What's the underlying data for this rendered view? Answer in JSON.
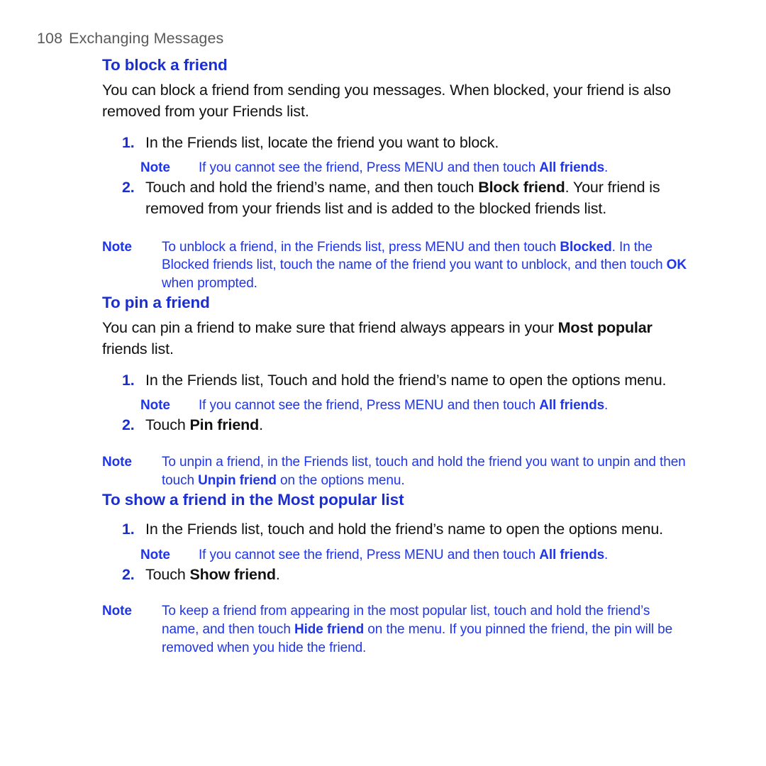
{
  "header": {
    "page_number": "108",
    "chapter_title": "Exchanging Messages"
  },
  "colors": {
    "heading_blue": "#1a2ed2",
    "note_blue": "#1f35e8",
    "body_black": "#111111",
    "header_gray": "#5a5a5a",
    "page_background": "#ffffff"
  },
  "sections": [
    {
      "heading": "To block a friend",
      "intro": "You can block a friend from sending you messages. When blocked, your friend is also removed from your Friends list.",
      "steps": [
        {
          "marker": "1.",
          "text_before": "In the Friends list, locate the friend you want to block.",
          "bold": "",
          "text_after": "",
          "note": {
            "label": "Note",
            "text_before": "If you cannot see the friend, Press MENU and then touch ",
            "bold": "All friends",
            "text_after": "."
          }
        },
        {
          "marker": "2.",
          "text_before": "Touch and hold the friend’s name, and then touch ",
          "bold": "Block friend",
          "text_after": ". Your friend is removed from your friends list and is added to the blocked friends list.",
          "note": null
        }
      ],
      "trailing_note": {
        "label": "Note",
        "segments": [
          {
            "text": "To unblock a friend, in the Friends list, press MENU and then touch ",
            "bold": false
          },
          {
            "text": "Blocked",
            "bold": true
          },
          {
            "text": ". In the Blocked friends list, touch the name of the friend you want to unblock, and then touch ",
            "bold": false
          },
          {
            "text": "OK",
            "bold": true
          },
          {
            "text": " when prompted.",
            "bold": false
          }
        ]
      }
    },
    {
      "heading": "To pin a friend",
      "intro_segments": [
        {
          "text": "You can pin a friend to make sure that friend always appears in your ",
          "bold": false
        },
        {
          "text": "Most popular",
          "bold": true
        },
        {
          "text": " friends list.",
          "bold": false
        }
      ],
      "steps": [
        {
          "marker": "1.",
          "text_before": "In the Friends list, Touch and hold the friend’s name to open the options menu.",
          "bold": "",
          "text_after": "",
          "note": {
            "label": "Note",
            "text_before": "If you cannot see the friend, Press MENU and then touch ",
            "bold": "All friends",
            "text_after": "."
          }
        },
        {
          "marker": "2.",
          "text_before": "Touch ",
          "bold": "Pin friend",
          "text_after": ".",
          "note": null
        }
      ],
      "trailing_note": {
        "label": "Note",
        "segments": [
          {
            "text": "To unpin a friend, in the Friends list, touch and hold the friend you want to unpin and then touch ",
            "bold": false
          },
          {
            "text": "Unpin friend",
            "bold": true
          },
          {
            "text": " on the options menu.",
            "bold": false
          }
        ]
      }
    },
    {
      "heading": "To show a friend in the Most popular list",
      "steps": [
        {
          "marker": "1.",
          "text_before": "In the Friends list, touch and hold the friend’s name to open the options menu.",
          "bold": "",
          "text_after": "",
          "note": {
            "label": "Note",
            "text_before": "If you cannot see the friend, Press MENU and then touch ",
            "bold": "All friends",
            "text_after": "."
          }
        },
        {
          "marker": "2.",
          "text_before": "Touch ",
          "bold": "Show friend",
          "text_after": ".",
          "note": null
        }
      ],
      "trailing_note": {
        "label": "Note",
        "segments": [
          {
            "text": "To keep a friend from appearing in the most popular list, touch and hold the friend’s name, and then touch ",
            "bold": false
          },
          {
            "text": "Hide friend",
            "bold": true
          },
          {
            "text": " on the menu. If you pinned the friend, the pin will be removed when you hide the friend.",
            "bold": false
          }
        ]
      }
    }
  ]
}
